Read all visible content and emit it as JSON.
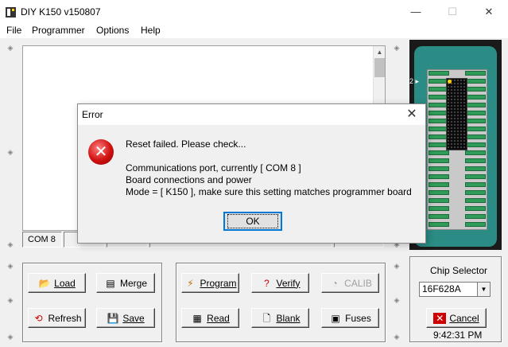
{
  "window": {
    "title": "DIY K150 v150807",
    "min_glyph": "—",
    "max_glyph": "☐",
    "close_glyph": "✕"
  },
  "menu": [
    "File",
    "Programmer",
    "Options",
    "Help"
  ],
  "status": {
    "com_port": "COM 8"
  },
  "chip_board": {
    "pin_label": "2"
  },
  "file_buttons": {
    "load": "Load",
    "merge": "Merge",
    "refresh": "Refresh",
    "save": "Save"
  },
  "prog_buttons": {
    "program": "Program",
    "verify": "Verify",
    "calib": "CALIB",
    "read": "Read",
    "blank": "Blank",
    "fuses": "Fuses"
  },
  "chip_selector": {
    "label": "Chip Selector",
    "selected": "16F628A",
    "cancel": "Cancel",
    "clock": "9:42:31 PM"
  },
  "dialog": {
    "title": "Error",
    "line1": "Reset failed. Please check...",
    "line2": "Communications port, currently [ COM 8 ]",
    "line3": "Board connections and power",
    "line4": "Mode =  [ K150 ], make sure this setting matches programmer board",
    "ok": "OK"
  },
  "colors": {
    "board": "#2a8c84",
    "pin": "#2f9b58",
    "error_icon": "#d01010",
    "focus": "#0078d7"
  }
}
